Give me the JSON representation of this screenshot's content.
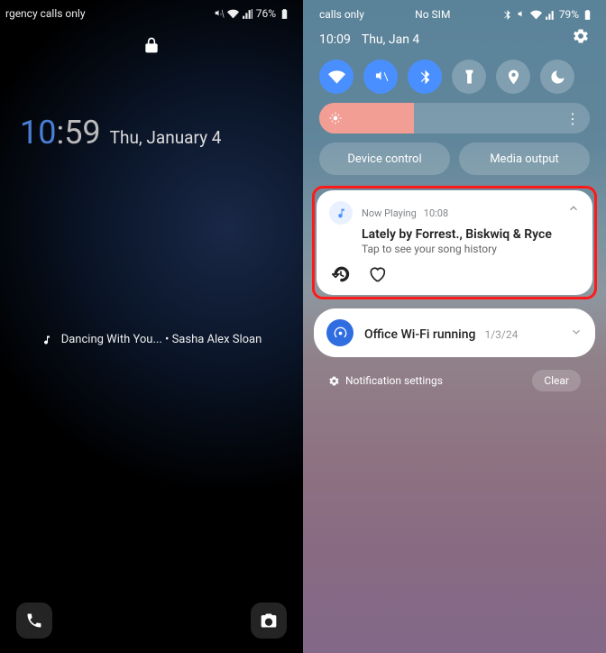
{
  "left": {
    "status_text": "rgency calls only",
    "battery": "76%",
    "clock": {
      "hour": "10",
      "minute": "59",
      "date": "Thu, January 4"
    },
    "music": "Dancing With You... • Sasha Alex Sloan"
  },
  "right": {
    "status_left": "calls only",
    "status_center": "No SIM",
    "battery": "79%",
    "header": {
      "time": "10:09",
      "date": "Thu, Jan 4"
    },
    "quick_settings": [
      {
        "name": "wifi",
        "on": true
      },
      {
        "name": "mute",
        "on": true
      },
      {
        "name": "bluetooth",
        "on": true
      },
      {
        "name": "flashlight",
        "on": false
      },
      {
        "name": "location",
        "on": false
      },
      {
        "name": "dnd",
        "on": false
      }
    ],
    "brightness_pct": 35,
    "buttons": {
      "device_control": "Device control",
      "media_output": "Media output"
    },
    "now_playing": {
      "app": "Now Playing",
      "time": "10:08",
      "title": "Lately by Forrest., Biskwiq & Ryce",
      "subtitle": "Tap to see your song history"
    },
    "wifi_notif": {
      "title": "Office Wi-Fi running",
      "date": "1/3/24"
    },
    "footer": {
      "settings": "Notification settings",
      "clear": "Clear"
    }
  }
}
